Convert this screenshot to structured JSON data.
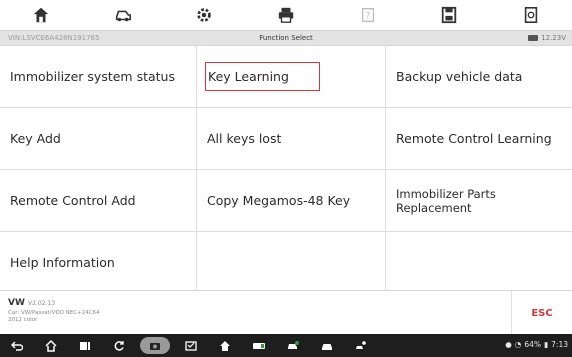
{
  "toolbar": {
    "icons": [
      "home-icon",
      "vehicle-icon",
      "settings-icon",
      "print-icon",
      "help-icon",
      "save-icon",
      "report-icon"
    ]
  },
  "infobar": {
    "vin": "VIN:LSVCE6A428N191765",
    "title": "Function Select",
    "voltage": "12.23V"
  },
  "functions": [
    {
      "label": "Immobilizer system status"
    },
    {
      "label": "Key Learning",
      "selected": true
    },
    {
      "label": "Backup vehicle data"
    },
    {
      "label": "Key Add"
    },
    {
      "label": "All keys lost"
    },
    {
      "label": "Remote Control Learning"
    },
    {
      "label": "Remote Control Add"
    },
    {
      "label": "Copy Megamos-48 Key"
    },
    {
      "label": "Immobilizer Parts Replacement"
    },
    {
      "label": "Help Information"
    }
  ],
  "footer": {
    "make": "VW",
    "version": "V2.02.13",
    "car_line1": "Car: VW/Passat/VDO NEC+24C64",
    "car_line2": "2012 color",
    "esc_label": "ESC"
  },
  "statusbar": {
    "battery": "64%",
    "time": "7:13"
  },
  "colors": {
    "accent_red": "#d23a3a",
    "selection_border": "#d9363e",
    "navbar_bg": "#1e1e1e"
  }
}
